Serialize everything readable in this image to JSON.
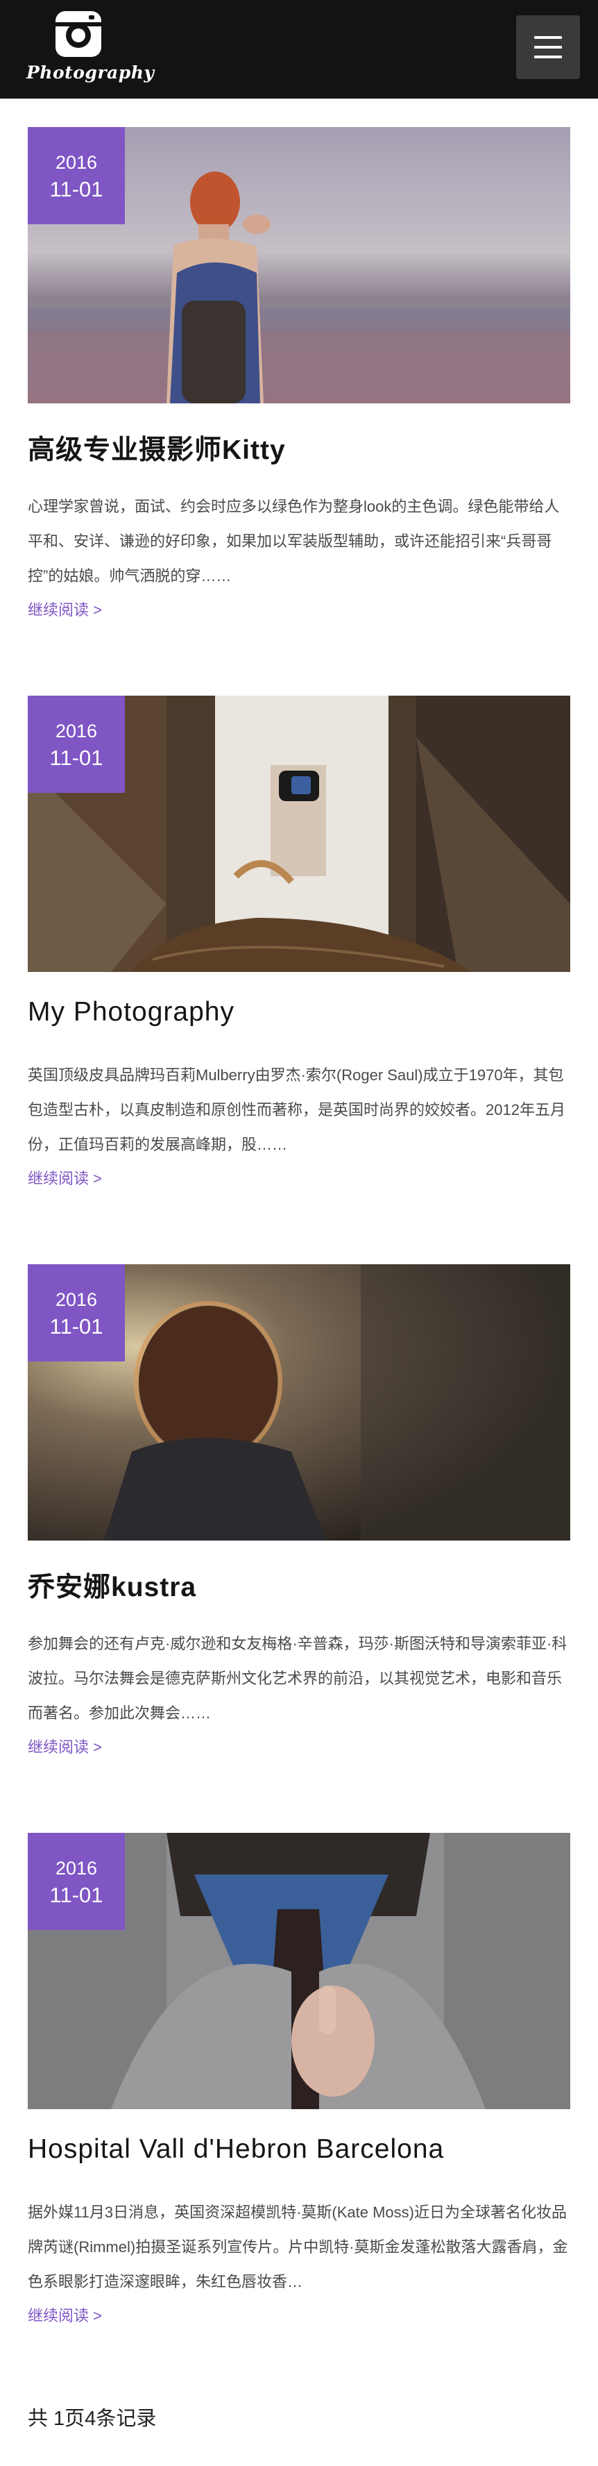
{
  "header": {
    "logo_text": "Photography",
    "menu_icon": "hamburger-menu-icon"
  },
  "articles": [
    {
      "year": "2016",
      "month_day": "11-01",
      "title": "高级专业摄影师Kitty",
      "description": "心理学家曾说，面试、约会时应多以绿色作为整身look的主色调。绿色能带给人平和、安详、谦逊的好印象，如果加以军装版型辅助，或许还能招引来“兵哥哥控”的姑娘。帅气洒脱的穿……",
      "more": "继续阅读 >"
    },
    {
      "year": "2016",
      "month_day": "11-01",
      "title": "My Photography",
      "description": "英国顶级皮具品牌玛百莉Mulberry由罗杰·索尔(Roger Saul)成立于1970年，其包包造型古朴，以真皮制造和原创性而著称，是英国时尚界的姣姣者。2012年五月份，正值玛百莉的发展高峰期，股……",
      "more": "继续阅读 >"
    },
    {
      "year": "2016",
      "month_day": "11-01",
      "title": "乔安娜kustra",
      "description": "参加舞会的还有卢克·威尔逊和女友梅格·辛普森，玛莎·斯图沃特和导演索菲亚·科波拉。马尔法舞会是德克萨斯州文化艺术界的前沿，以其视觉艺术，电影和音乐而著名。参加此次舞会……",
      "more": "继续阅读 >"
    },
    {
      "year": "2016",
      "month_day": "11-01",
      "title": "Hospital Vall d'Hebron Barcelona",
      "description": "据外媒11月3日消息，英国资深超模凯特·莫斯(Kate Moss)近日为全球著名化妆品牌芮谜(Rimmel)拍摄圣诞系列宣传片。片中凯特·莫斯金发蓬松散落大露香肩，金色系眼影打造深邃眼眸，朱红色唇妆香…",
      "more": "继续阅读 >"
    }
  ],
  "pager": {
    "summary": "共 1页4条记录"
  }
}
